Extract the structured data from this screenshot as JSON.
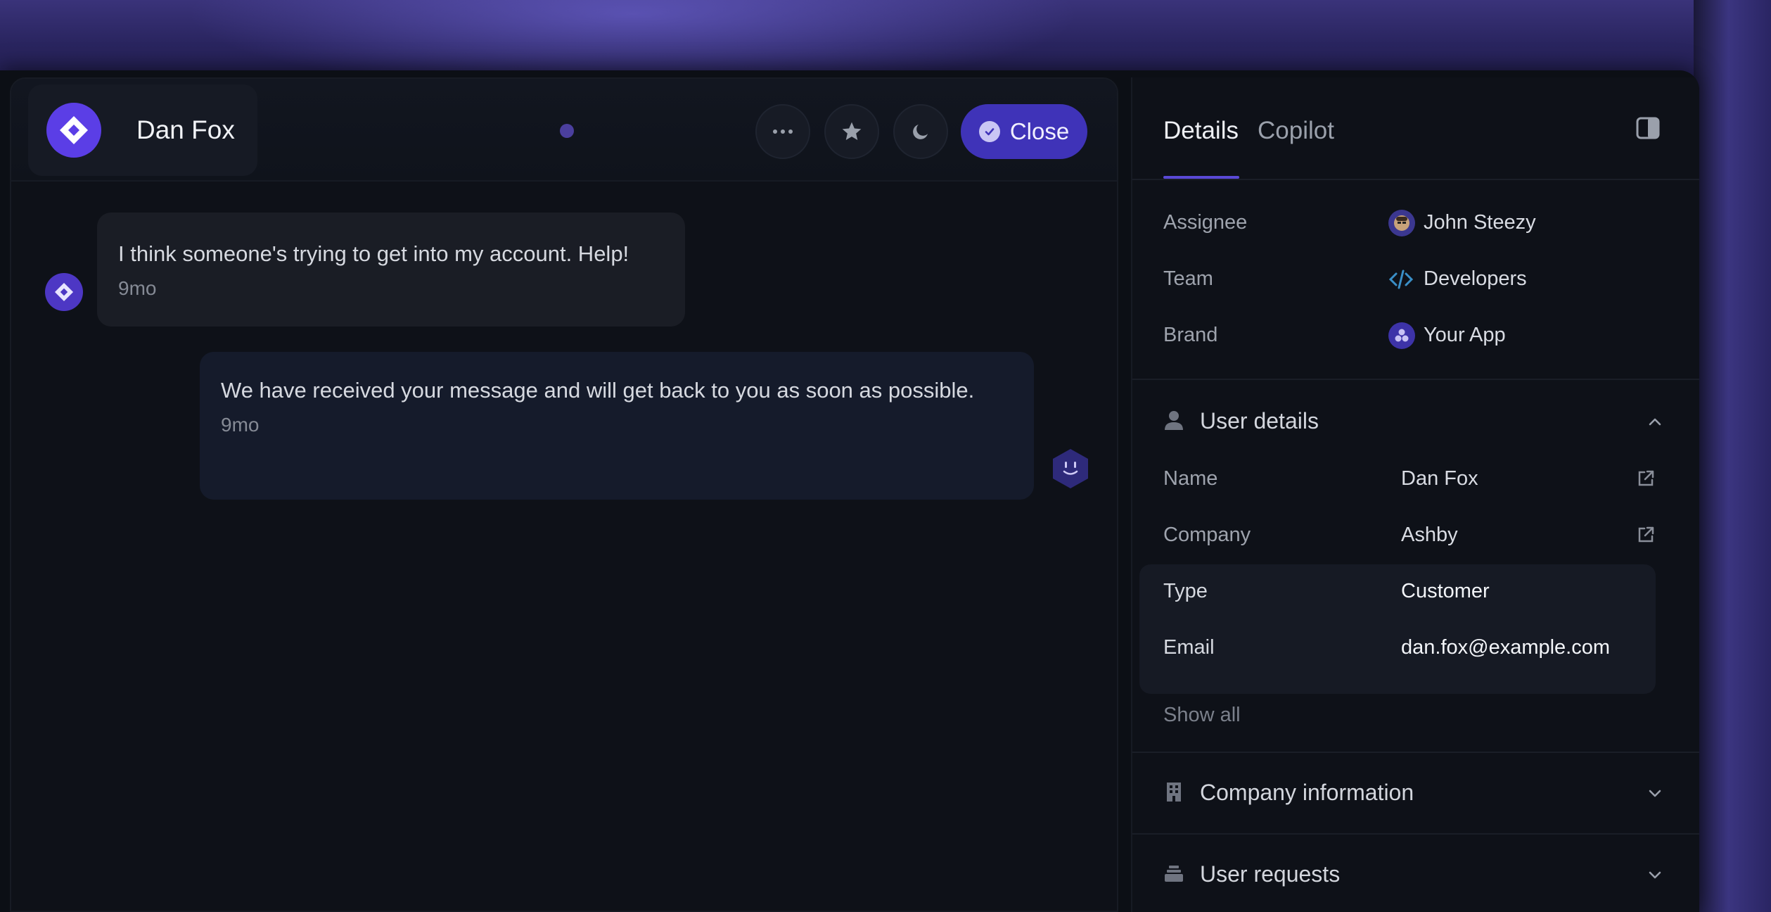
{
  "conversation": {
    "user_name": "Dan Fox",
    "close_label": "Close",
    "messages": [
      {
        "from": "user",
        "text": "I think someone's trying to get into my account. Help!",
        "time": "9mo"
      },
      {
        "from": "bot",
        "text": "We have received your message and will get back to you as soon as possible.",
        "time": "9mo"
      }
    ]
  },
  "details": {
    "tabs": [
      "Details",
      "Copilot"
    ],
    "active_tab": "Details",
    "fields": [
      {
        "label": "Assignee",
        "value": "John Steezy"
      },
      {
        "label": "Team",
        "value": "Developers"
      },
      {
        "label": "Brand",
        "value": "Your App"
      }
    ],
    "user_details": {
      "title": "User details",
      "rows": [
        {
          "label": "Name",
          "value": "Dan Fox"
        },
        {
          "label": "Company",
          "value": "Ashby"
        },
        {
          "label": "Type",
          "value": "Customer"
        },
        {
          "label": "Email",
          "value": "dan.fox@example.com"
        }
      ],
      "show_all": "Show all"
    },
    "company_information": {
      "title": "Company information"
    },
    "user_requests": {
      "title": "User requests"
    }
  },
  "colors": {
    "accent": "#3f33b8",
    "brand": "#5b3ee6"
  }
}
